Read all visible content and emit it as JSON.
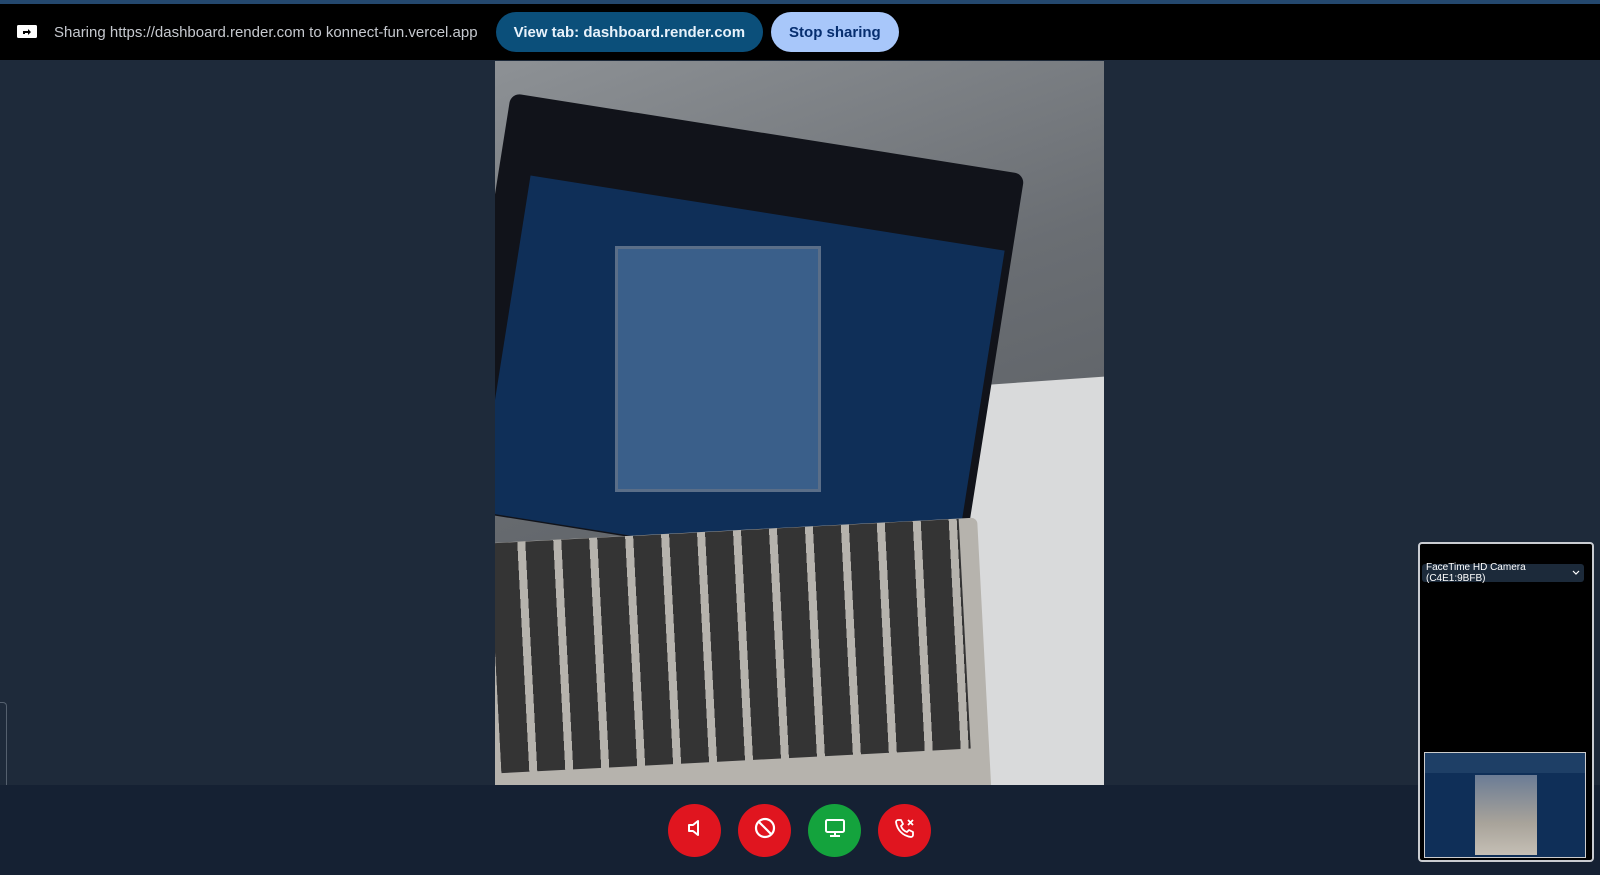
{
  "share_bar": {
    "sharing_text": "Sharing https://dashboard.render.com to konnect-fun.vercel.app",
    "view_tab_label": "View tab: dashboard.render.com",
    "stop_sharing_label": "Stop sharing"
  },
  "camera_select": {
    "selected": "FaceTime HD Camera (C4E1:9BFB)"
  },
  "controls": [
    {
      "icon": "speaker-mute-icon",
      "color": "#e0151f"
    },
    {
      "icon": "block-video-icon",
      "color": "#e0151f"
    },
    {
      "icon": "screen-share-icon",
      "color": "#14a33d"
    },
    {
      "icon": "end-call-icon",
      "color": "#e0151f"
    }
  ],
  "colors": {
    "background": "#1e2a3a",
    "share_bar": "#000000",
    "view_tab_button": "#0b4f7a",
    "stop_button": "#a8c7fa"
  }
}
